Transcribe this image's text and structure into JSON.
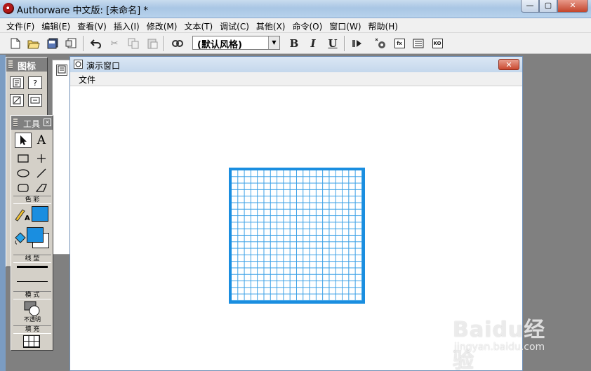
{
  "window": {
    "title": "Authorware 中文版: [未命名] *",
    "minimize_label": "—",
    "maximize_label": "▢",
    "close_label": "✕"
  },
  "menubar": {
    "items": [
      "文件(F)",
      "编辑(E)",
      "查看(V)",
      "插入(I)",
      "修改(M)",
      "文本(T)",
      "调试(C)",
      "其他(X)",
      "命令(O)",
      "窗口(W)",
      "帮助(H)"
    ]
  },
  "toolbar": {
    "style_value": "(默认风格)",
    "bold_label": "B",
    "italic_label": "I",
    "underline_label": "U",
    "fx_label": "fx",
    "ko_label": "KO"
  },
  "icon_palette": {
    "title": "图标"
  },
  "tools_palette": {
    "title": "工具",
    "text_tool": "A",
    "section_color": "色 彩",
    "section_line": "线 型",
    "section_mode": "模 式",
    "mode_value": "不透明",
    "section_fill": "填 充",
    "pen_color": "#1a8ee0",
    "fill_fg_color": "#1a8ee0",
    "fill_bg_color": "#ffffff"
  },
  "presentation_window": {
    "title": "演示窗口",
    "menu_file": "文件",
    "close_label": "✕"
  },
  "watermark": {
    "brand": "Baidu经验",
    "url": "jingyan.baidu.com"
  },
  "colors": {
    "grid_line": "#39a0e6",
    "grid_border": "#1a8ee0"
  }
}
